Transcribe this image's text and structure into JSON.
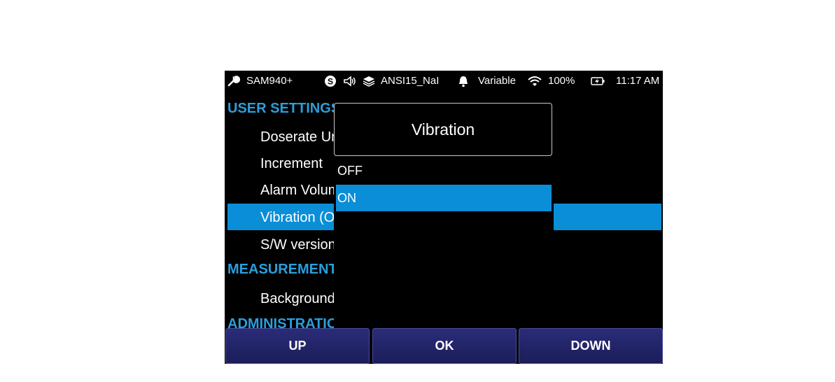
{
  "status_bar": {
    "device_name": "SAM940+",
    "profile": "ANSI15_NaI",
    "alarm_mode": "Variable",
    "battery": "100%",
    "time": "11:17 AM",
    "icons": [
      "wrench-icon",
      "s-circle-icon",
      "speaker-icon",
      "library-icon",
      "bell-icon",
      "wifi-icon",
      "battery-icon"
    ]
  },
  "menu": {
    "rows": [
      {
        "type": "section",
        "label": "USER SETTINGS"
      },
      {
        "type": "entry",
        "label": "Doserate Units"
      },
      {
        "type": "entry",
        "label": "Increment"
      },
      {
        "type": "entry",
        "label": "Alarm Volume"
      },
      {
        "type": "entry",
        "label": "Vibration (ON)",
        "selected": true
      },
      {
        "type": "entry",
        "label": "S/W version"
      },
      {
        "type": "section",
        "label": "MEASUREMENT"
      },
      {
        "type": "entry",
        "label": "Background"
      },
      {
        "type": "section",
        "label": "ADMINISTRATION"
      }
    ]
  },
  "dialog": {
    "title": "Vibration",
    "options": [
      {
        "label": "OFF",
        "selected": false
      },
      {
        "label": "ON",
        "selected": true
      }
    ]
  },
  "buttons": {
    "up": "UP",
    "ok": "OK",
    "down": "DOWN"
  },
  "colors": {
    "accent": "#0a8ed8",
    "section": "#2a9fdc",
    "button": "#22236a"
  }
}
